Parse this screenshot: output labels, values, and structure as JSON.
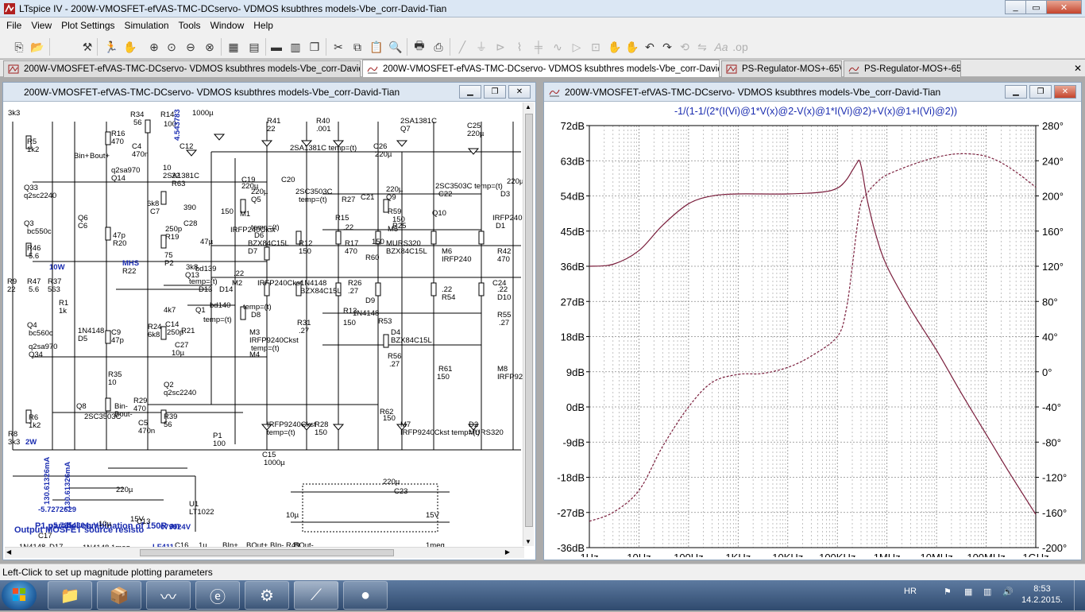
{
  "app": {
    "title": "LTspice IV - 200W-VMOSFET-efVAS-TMC-DCservo- VDMOS ksubthres models-Vbe_corr-David-Tian",
    "window_buttons": [
      "minimize",
      "maximize",
      "close"
    ]
  },
  "menu": [
    "File",
    "View",
    "Plot Settings",
    "Simulation",
    "Tools",
    "Window",
    "Help"
  ],
  "toolbar_icons": [
    "new-schematic",
    "open",
    "run",
    "halt",
    "zoom-in",
    "pan",
    "zoom-in",
    "zoom-out",
    "zoom-fit",
    "zoom-cancel",
    "autorange",
    "tile-horizontal",
    "tile-vertical",
    "cascade",
    "cut",
    "copy",
    "paste",
    "find",
    "print-setup",
    "print",
    "wire",
    "ground",
    "label-net",
    "component",
    "resistor",
    "capacitor",
    "inductor",
    "diode",
    "spice-directive",
    "move",
    "drag",
    "undo",
    "redo",
    "rotate",
    "mirror",
    "text"
  ],
  "tabs": [
    {
      "label": "200W-VMOSFET-efVAS-TMC-DCservo- VDMOS ksubthres models-Vbe_corr-David-Tian",
      "type": "schematic"
    },
    {
      "label": "200W-VMOSFET-efVAS-TMC-DCservo- VDMOS ksubthres models-Vbe_corr-David-Tian",
      "type": "waveform"
    },
    {
      "label": "PS-Regulator-MOS+-65V",
      "type": "schematic"
    },
    {
      "label": "PS-Regulator-MOS+-65V",
      "type": "waveform"
    }
  ],
  "schematic_window": {
    "title": "200W-VMOSFET-efVAS-TMC-DCservo- VDMOS ksubthres models-Vbe_corr-David-Tian",
    "labels": [
      "3k3",
      "R5",
      "1k2",
      "Q33",
      "q2sc2240",
      "Q3",
      "bc550c",
      "R46",
      "5.6",
      "R9",
      "22",
      "R47",
      "5.6",
      "R37",
      "563",
      "R1",
      "1k",
      "Q4",
      "bc560c",
      "q2sa970",
      "Q34",
      "R6",
      "1k2",
      "R8",
      "3k3",
      "2W",
      "10W",
      "R34",
      "56",
      "R16",
      "470",
      "Bin+",
      "Bout+",
      "C4",
      "470n",
      "q2sa970",
      "Q14",
      "R14",
      "100",
      "4.543783",
      "C12",
      "1000µ",
      "22",
      "R63",
      "10",
      "2SA1381C",
      "Q6",
      "C6",
      "47p",
      "R20",
      "6k8",
      "C7",
      "250p",
      "R19",
      "390",
      "C28",
      "47µ",
      "MHS",
      "R22",
      "75",
      "P2",
      "3k8",
      "Q13",
      "bd139",
      "temp=(t)",
      "D13",
      "D14",
      "1N4148",
      "D5",
      "C9",
      "47p",
      "R24",
      "6k8",
      "C14",
      "250p",
      "R21",
      "4k7",
      "Q1",
      "bd140",
      "temp=(t)",
      "C27",
      "10µ",
      "R35",
      "10",
      "Q2",
      "q2sc2240",
      "Q8",
      "2SC3503C",
      "Bin-",
      "Bout-",
      "R29",
      "470",
      "C5",
      "470n",
      "R39",
      "56",
      "P1",
      "100",
      "C15",
      "1000µ",
      "R41",
      "22",
      "R40",
      ".001",
      "C19",
      "220µ",
      "C20",
      "220µ",
      "Q5",
      "2SC3503C",
      "temp=(t)",
      "R27",
      "150",
      "M1",
      "IRFP240Ckst",
      "temp=(t)",
      "D6",
      "BZX84C15L",
      "D7",
      "R12",
      "150",
      "R17",
      "470",
      "R15",
      ".22",
      "R25",
      ".22",
      "M2",
      "IRFP240Ckst",
      "temp=(t)",
      "D8",
      "1N4148",
      "BZX84C15L",
      "R26",
      ".27",
      "R13",
      "150",
      "R31",
      ".27",
      "M3",
      "IRFP9240Ckst",
      "temp=(t)",
      "M4",
      "IRFP9240Ckst",
      "temp=(t)",
      "R28",
      "150",
      "2SA1381C",
      "Q7",
      "C26",
      "220µ",
      "C25",
      "220µ",
      "C21",
      "220µ",
      "Q9",
      "2SC3503C temp=(t)",
      "C22",
      "220µ",
      "D3",
      "R59",
      "150",
      "M5",
      "IRFP240Ckst temp=(t)",
      "D1",
      "MURS320",
      "BZX84C15L",
      "R60",
      "150",
      "M6",
      "IRFP240",
      "R42",
      "470",
      "D9",
      "1N4148",
      "R53",
      ".22",
      "R54",
      ".22",
      "D10",
      "D4",
      "BZX84C15L",
      "R55",
      ".27",
      "R56",
      ".27",
      "R61",
      "150",
      "M8",
      "IRFP9240",
      "R62",
      "150",
      "M7",
      "IRFP9240Ckst temp=(t)",
      "D2",
      "MURS320",
      "2SA1381C temp=(t)",
      "Q10",
      "C24",
      "220µ",
      "C23",
      "220µ",
      "130.61326mA",
      "130.61326mA",
      "-5.7272629",
      "P1 parallel combination of 150R an",
      "Output MOSFET source resisto",
      "-5.7354304µV",
      "C17",
      "10µ",
      "15V",
      "C13",
      "079924V",
      "U1",
      "LT1022",
      "1N4148",
      "D17",
      "D18",
      "1N4148",
      "R43",
      "1meg",
      "LF411",
      "C18",
      "10µ",
      "15V",
      "R49",
      "1meg",
      "C16",
      "1µ",
      "BIn+",
      "BOut+",
      "BIn-",
      "BOut-"
    ]
  },
  "waveform_window": {
    "title": "200W-VMOSFET-efVAS-TMC-DCservo- VDMOS ksubthres models-Vbe_corr-David-Tian",
    "trace_expr": "-1/(1-1/(2*(I(Vi)@1*V(x)@2-V(x)@1*I(Vi)@2)+V(x)@1+I(Vi)@2))"
  },
  "chart_data": {
    "type": "line",
    "title": "-1/(1-1/(2*(I(Vi)@1*V(x)@2-V(x)@1*I(Vi)@2)+V(x)@1+I(Vi)@2))",
    "x_scale": "log",
    "x_ticks": [
      "1Hz",
      "10Hz",
      "100Hz",
      "1KHz",
      "10KHz",
      "100KHz",
      "1MHz",
      "10MHz",
      "100MHz",
      "1GHz"
    ],
    "x_values_hz": [
      1,
      10,
      100,
      1000,
      10000,
      100000,
      1000000,
      10000000,
      100000000,
      1000000000
    ],
    "xlim_hz": [
      1,
      1000000000
    ],
    "y_left_ticks": [
      "72dB",
      "63dB",
      "54dB",
      "45dB",
      "36dB",
      "27dB",
      "18dB",
      "9dB",
      "0dB",
      "-9dB",
      "-18dB",
      "-27dB",
      "-36dB"
    ],
    "ylim_left_db": [
      -36,
      72
    ],
    "y_right_ticks": [
      "280°",
      "240°",
      "200°",
      "160°",
      "120°",
      "80°",
      "40°",
      "0°",
      "-40°",
      "-80°",
      "-120°",
      "-160°",
      "-200°"
    ],
    "ylim_right_deg": [
      -200,
      280
    ],
    "grid": true,
    "trace_color": "#7a1e3c",
    "series": [
      {
        "kind": "magnitude_db",
        "style": "solid",
        "x": [
          1,
          3,
          10,
          30,
          100,
          300,
          1000,
          10000,
          50000,
          100000,
          150000,
          200000,
          250000,
          280000,
          320000,
          400000,
          600000,
          1000000,
          3000000,
          10000000,
          30000000,
          100000000,
          300000000,
          1000000000
        ],
        "y": [
          36,
          36.5,
          40,
          46.5,
          52,
          54,
          54.5,
          54.5,
          55,
          56,
          58,
          60.5,
          62.5,
          63,
          60,
          53,
          44,
          36,
          25,
          14.5,
          4,
          -7,
          -17,
          -27.5
        ]
      },
      {
        "kind": "phase_deg",
        "style": "dashed",
        "x": [
          1,
          3,
          10,
          30,
          100,
          300,
          1000,
          3000,
          10000,
          30000,
          100000,
          150000,
          200000,
          250000,
          300000,
          400000,
          500000,
          700000,
          1000000,
          3000000,
          10000000,
          30000000,
          100000000,
          300000000,
          1000000000
        ],
        "y": [
          -170,
          -160,
          -135,
          -85,
          -40,
          -12,
          -3,
          -2,
          5,
          18,
          40,
          70,
          120,
          165,
          192,
          203,
          210,
          218,
          224,
          235,
          244,
          248,
          245,
          232,
          210
        ]
      }
    ]
  },
  "status": {
    "text": "Left-Click to set up magnitude plotting parameters"
  },
  "taskbar": {
    "apps": [
      "start",
      "file-explorer",
      "installer",
      "oscilloscope",
      "internet-explorer",
      "settings",
      "ltspice",
      "green-app"
    ],
    "tray": {
      "language": "HR",
      "icons": [
        "flag-icon",
        "network-icon",
        "volume-icon"
      ],
      "time": "8:53",
      "date": "14.2.2015."
    }
  }
}
